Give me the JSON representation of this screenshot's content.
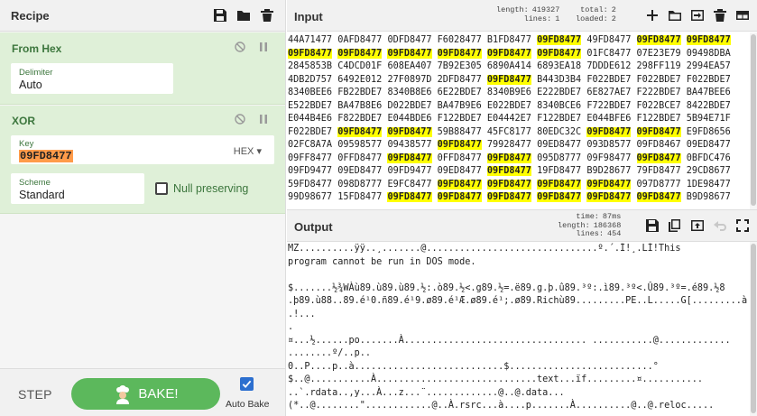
{
  "recipe": {
    "title": "Recipe",
    "icons": [
      "save-icon",
      "folder-icon",
      "trash-icon"
    ],
    "operations": [
      {
        "name": "From Hex",
        "delimiter_label": "Delimiter",
        "delimiter_value": "Auto"
      },
      {
        "name": "XOR",
        "key_label": "Key",
        "key_value": "09FD8477",
        "key_format": "HEX",
        "scheme_label": "Scheme",
        "scheme_value": "Standard",
        "null_preserving_label": "Null preserving"
      }
    ],
    "step_label": "STEP",
    "bake_label": "BAKE!",
    "auto_bake_label": "Auto Bake",
    "auto_bake_checked": true
  },
  "input": {
    "title": "Input",
    "stats": {
      "length_label": "length:",
      "length": "419327",
      "lines_label": "lines:",
      "lines": "1",
      "total_label": "total:",
      "total": "2",
      "loaded_label": "loaded:",
      "loaded": "2"
    },
    "highlight": "09FD8477",
    "lines": [
      "44A71477 0AFD8477 0DFD8477 F6028477 B1FD8477 09FD8477 49FD8477 09FD8477 09FD8477",
      "09FD8477 09FD8477 09FD8477 09FD8477 09FD8477 09FD8477 01FC8477 07E23E79 09498DBA",
      "2845853B C4DCD01F 608EA407 7B92E305 6890A414 6893EA18 7DDDE612 298FF119 2994EA57",
      "4DB2D757 6492E012 27F0897D 2DFD8477 09FD8477 B443D3B4 F022BDE7 F022BDE7 F022BDE7",
      "8340BEE6 FB22BDE7 8340B8E6 6E22BDE7 8340B9E6 E222BDE7 6E827AE7 F222BDE7 BA47BEE6",
      "E522BDE7 BA47B8E6 D022BDE7 BA47B9E6 E022BDE7 8340BCE6 F722BDE7 F022BCE7 8422BDE7",
      "E044B4E6 F822BDE7 E044BDE6 F122BDE7 E04442E7 F122BDE7 E044BFE6 F122BDE7 5B94E71F",
      "F022BDE7 09FD8477 09FD8477 59B88477 45FC8177 80EDC32C 09FD8477 09FD8477 E9FD8656",
      "02FC8A7A 09598577 09438577 09FD8477 79928477 09ED8477 093D8577 09FD8467 09ED8477",
      "09FF8477 0FFD8477 09FD8477 0FFD8477 09FD8477 095D8777 09F98477 09FD8477 0BFDC476",
      "09FD9477 09ED8477 09FD9477 09ED8477 09FD8477 19FD8477 B9D28677 79FD8477 29CD8677",
      "59FD8477 098D8777 E9FC8477 09FD8477 09FD8477 09FD8477 09FD8477 097D8777 1DE98477",
      "99D98677 15FD8477 09FD8477 09FD8477 09FD8477 09FD8477 09FD8477 09FD8477 B9D98677"
    ]
  },
  "output": {
    "title": "Output",
    "stats": {
      "time_label": "time:",
      "time": "87ms",
      "length_label": "length:",
      "length": "186368",
      "lines_label": "lines:",
      "lines": "454"
    },
    "lines": [
      "MZ..........ÿÿ..¸.......@...............................º.´.Í!¸.LÍ!This",
      "program cannot be run in DOS mode.",
      "",
      "$.......½¾WÀù89.ù89.ù89.½:.ò89.½<.g89.½=.ë89.g.þ.û89.³º:.ì89.³º<.Û89.³º=.é89.½8",
      ".þ89.ù88..89.é¹0.ñ89.é¹9.ø89.é¹Æ.ø89.é¹;.ø89.Richù89.........PE..L.....G[.........à.",
      ".!...",
      ".",
      "¤...½......po.......À................................. ...........@.............",
      "........º/..p..",
      "0..P....p..à...........................$..........................°",
      "$..@...........À.............................text...ïf.........¤...........",
      "..`.rdata..,y...À...z...¨.............@..@.data...",
      "(*..@........\"............@..À.rsrc...à....p.......À..........@..@.reloc....."
    ]
  }
}
